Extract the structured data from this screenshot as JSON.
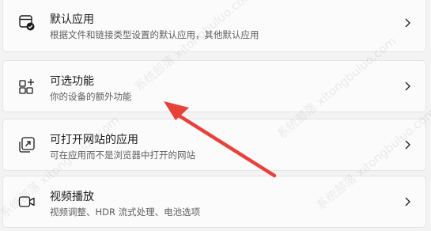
{
  "settings": {
    "items": [
      {
        "title": "默认应用",
        "desc": "根据文件和链接类型设置的默认应用，其他默认应用",
        "icon": "default-apps-icon"
      },
      {
        "title": "可选功能",
        "desc": "你的设备的额外功能",
        "icon": "optional-features-icon"
      },
      {
        "title": "可打开网站的应用",
        "desc": "可在应用而不是浏览器中打开的网站",
        "icon": "apps-for-websites-icon"
      },
      {
        "title": "视频播放",
        "desc": "视频调整、HDR 流式处理、电池选项",
        "icon": "video-playback-icon"
      }
    ]
  },
  "annotation": {
    "color": "#e8413a"
  },
  "watermark": {
    "text": "系统部落 xitongbuluo.com"
  }
}
